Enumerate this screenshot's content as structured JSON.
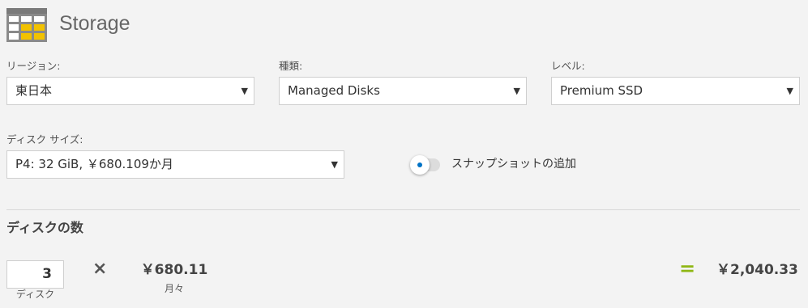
{
  "header": {
    "title": "Storage",
    "icon": "storage-table-icon"
  },
  "colors": {
    "accent": "#0072c6",
    "equals": "#8fb714",
    "icon_yellow": "#f2c200",
    "icon_gray": "#8a8a8a"
  },
  "fields": {
    "region": {
      "label": "リージョン:",
      "value": "東日本"
    },
    "type": {
      "label": "種類:",
      "value": "Managed Disks"
    },
    "tier": {
      "label": "レベル:",
      "value": "Premium SSD"
    },
    "disk_size": {
      "label": "ディスク サイズ:",
      "value": "P4: 32 GiB, ￥680.109か月"
    }
  },
  "snapshot_toggle": {
    "label": "スナップショットの追加",
    "on": false
  },
  "disk_count": {
    "title": "ディスクの数",
    "quantity": "3",
    "quantity_unit": "ディスク",
    "times_symbol": "×",
    "unit_price": "￥680.11",
    "unit_period": "月々",
    "equals_symbol": "=",
    "total": "￥2,040.33"
  }
}
